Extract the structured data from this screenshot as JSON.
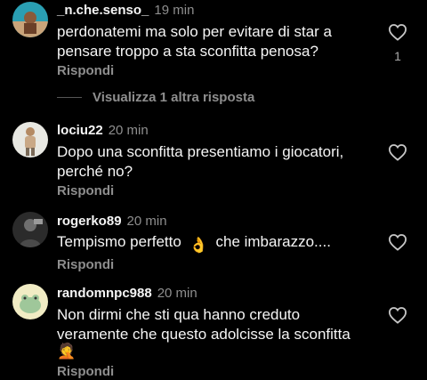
{
  "comments": [
    {
      "username": "_n.che.senso_",
      "time": "19 min",
      "text": "perdonatemi ma solo per evitare di star a pensare troppo a sta sconfitta penosa?",
      "reply": "Rispondi",
      "likes": "1",
      "avatar_icon": "beach-avatar-icon"
    },
    {
      "username": "lociu22",
      "time": "20 min",
      "text": "Dopo una sconfitta presentiamo i giocatori, perché no?",
      "reply": "Rispondi",
      "avatar_icon": "person-avatar-icon"
    },
    {
      "username": "rogerko89",
      "time": "20 min",
      "text_before": "Tempismo perfetto",
      "emoji": "👌",
      "text_after": "che imbarazzo....",
      "reply": "Rispondi",
      "avatar_icon": "dark-person-avatar-icon"
    },
    {
      "username": "randomnpc988",
      "time": "20 min",
      "text": "Non dirmi che sti qua hanno creduto veramente che questo adolcisse la sconfitta",
      "emoji": "🤦",
      "reply": "Rispondi",
      "avatar_icon": "frog-avatar-icon"
    }
  ],
  "view_more_replies": "Visualizza 1 altra risposta",
  "colors": {
    "background": "#000000",
    "text": "#f5f5f5",
    "muted": "#8e8e8e"
  }
}
